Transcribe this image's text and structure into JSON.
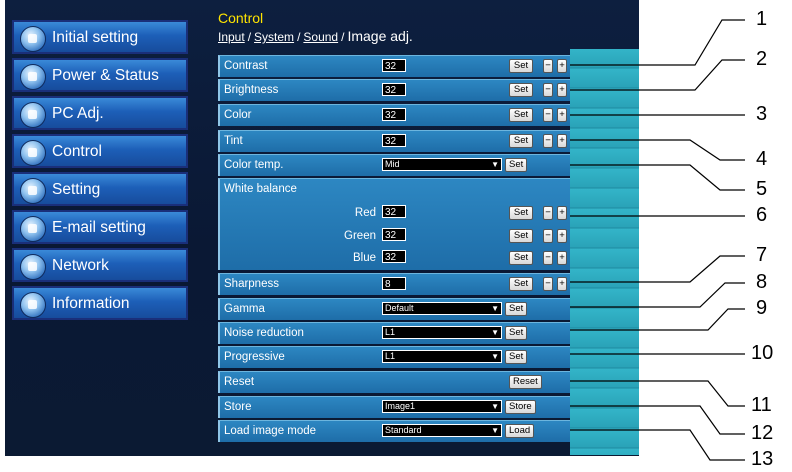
{
  "sidebar": {
    "items": [
      {
        "label": "Initial setting",
        "icon": "gear-icon"
      },
      {
        "label": "Power & Status",
        "icon": "power-icon"
      },
      {
        "label": "PC Adj.",
        "icon": "monitor-icon"
      },
      {
        "label": "Control",
        "icon": "control-icon"
      },
      {
        "label": "Setting",
        "icon": "wrench-icon"
      },
      {
        "label": "E-mail setting",
        "icon": "mail-icon"
      },
      {
        "label": "Network",
        "icon": "network-icon"
      },
      {
        "label": "Information",
        "icon": "info-icon"
      }
    ]
  },
  "header": {
    "title": "Control",
    "breadcrumb": [
      "Input",
      "System",
      "Sound"
    ],
    "current": "Image adj."
  },
  "rows": {
    "contrast": {
      "label": "Contrast",
      "value": "32"
    },
    "brightness": {
      "label": "Brightness",
      "value": "32"
    },
    "color": {
      "label": "Color",
      "value": "32"
    },
    "tint": {
      "label": "Tint",
      "value": "32"
    },
    "color_temp": {
      "label": "Color temp.",
      "value": "Mid"
    },
    "white_balance": {
      "label": "White balance",
      "red_label": "Red",
      "red": "32",
      "green_label": "Green",
      "green": "32",
      "blue_label": "Blue",
      "blue": "32"
    },
    "sharpness": {
      "label": "Sharpness",
      "value": "8"
    },
    "gamma": {
      "label": "Gamma",
      "value": "Default"
    },
    "noise": {
      "label": "Noise reduction",
      "value": "L1"
    },
    "progressive": {
      "label": "Progressive",
      "value": "L1"
    },
    "reset": {
      "label": "Reset"
    },
    "store": {
      "label": "Store",
      "value": "Image1"
    },
    "load": {
      "label": "Load image mode",
      "value": "Standard"
    }
  },
  "buttons": {
    "set": "Set",
    "minus": "−",
    "plus": "+",
    "reset": "Reset",
    "store": "Store",
    "load": "Load",
    "arrow": "▼"
  },
  "callouts": [
    "1",
    "2",
    "3",
    "4",
    "5",
    "6",
    "7",
    "8",
    "9",
    "10",
    "11",
    "12",
    "13"
  ]
}
